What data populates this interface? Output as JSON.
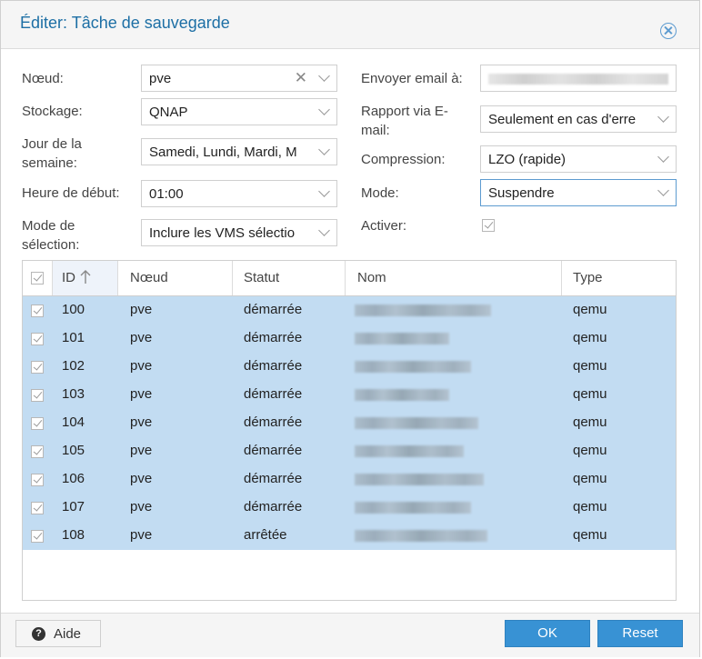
{
  "dialog": {
    "title": "Éditer: Tâche de sauvegarde"
  },
  "form": {
    "node": {
      "label": "Nœud:",
      "value": "pve"
    },
    "storage": {
      "label": "Stockage:",
      "value": "QNAP"
    },
    "weekday": {
      "label": "Jour de la semaine:",
      "value": "Samedi, Lundi, Mardi, M"
    },
    "start_time": {
      "label": "Heure de début:",
      "value": "01:00"
    },
    "selection_mode": {
      "label": "Mode de sélection:",
      "value": "Inclure les VMS sélectio"
    },
    "email": {
      "label": "Envoyer email à:",
      "value": ""
    },
    "email_report": {
      "label": "Rapport via E-mail:",
      "value": "Seulement en cas d'erre"
    },
    "compression": {
      "label": "Compression:",
      "value": "LZO (rapide)"
    },
    "mode": {
      "label": "Mode:",
      "value": "Suspendre"
    },
    "enable": {
      "label": "Activer:",
      "checked": true
    }
  },
  "grid": {
    "columns": [
      "ID",
      "Nœud",
      "Statut",
      "Nom",
      "Type"
    ],
    "sort_column": "ID",
    "sort_icon": "arrow-up-icon",
    "rows": [
      {
        "id": "100",
        "node": "pve",
        "status": "démarrée",
        "type": "qemu",
        "selected": true
      },
      {
        "id": "101",
        "node": "pve",
        "status": "démarrée",
        "type": "qemu",
        "selected": true
      },
      {
        "id": "102",
        "node": "pve",
        "status": "démarrée",
        "type": "qemu",
        "selected": true
      },
      {
        "id": "103",
        "node": "pve",
        "status": "démarrée",
        "type": "qemu",
        "selected": true
      },
      {
        "id": "104",
        "node": "pve",
        "status": "démarrée",
        "type": "qemu",
        "selected": true
      },
      {
        "id": "105",
        "node": "pve",
        "status": "démarrée",
        "type": "qemu",
        "selected": true
      },
      {
        "id": "106",
        "node": "pve",
        "status": "démarrée",
        "type": "qemu",
        "selected": true
      },
      {
        "id": "107",
        "node": "pve",
        "status": "démarrée",
        "type": "qemu",
        "selected": true
      },
      {
        "id": "108",
        "node": "pve",
        "status": "arrêtée",
        "type": "qemu",
        "selected": true
      }
    ]
  },
  "footer": {
    "help_label": "Aide",
    "ok_label": "OK",
    "reset_label": "Reset"
  },
  "colors": {
    "accent": "#3892d4",
    "title": "#1d6fa5",
    "row_selected": "#c2dcf2"
  }
}
